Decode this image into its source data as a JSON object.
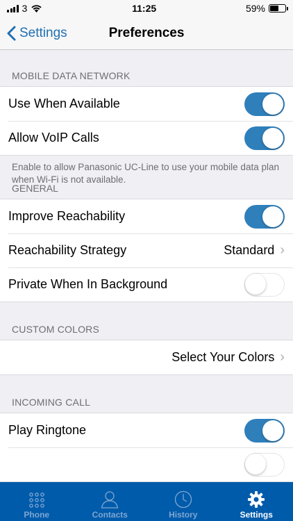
{
  "status": {
    "carrier": "3",
    "time": "11:25",
    "battery": "59%",
    "battery_level": 0.59
  },
  "nav": {
    "back_label": "Settings",
    "title": "Preferences"
  },
  "mobile": {
    "header": "MOBILE DATA NETWORK",
    "use_when_available": {
      "label": "Use When Available",
      "on": true
    },
    "allow_voip": {
      "label": "Allow VoIP Calls",
      "on": true
    },
    "footer": "Enable to allow Panasonic UC-Line to use your mobile data plan when Wi-Fi is not available."
  },
  "general": {
    "header": "GENERAL",
    "improve_reachability": {
      "label": "Improve Reachability",
      "on": true
    },
    "reachability_strategy": {
      "label": "Reachability Strategy",
      "value": "Standard"
    },
    "private_background": {
      "label": "Private When In Background",
      "on": false
    }
  },
  "colors": {
    "header": "CUSTOM COLORS",
    "select_label": "Select Your Colors"
  },
  "incoming": {
    "header": "INCOMING CALL",
    "play_ringtone": {
      "label": "Play Ringtone",
      "on": true
    }
  },
  "tabs": [
    {
      "label": "Phone",
      "icon": "keypad-icon"
    },
    {
      "label": "Contacts",
      "icon": "person-icon"
    },
    {
      "label": "History",
      "icon": "clock-icon"
    },
    {
      "label": "Settings",
      "icon": "gear-icon",
      "active": true
    }
  ],
  "colors_theme": {
    "accent": "#2f7fbb",
    "tab_bar": "#005bab",
    "link": "#1f6fb2"
  }
}
